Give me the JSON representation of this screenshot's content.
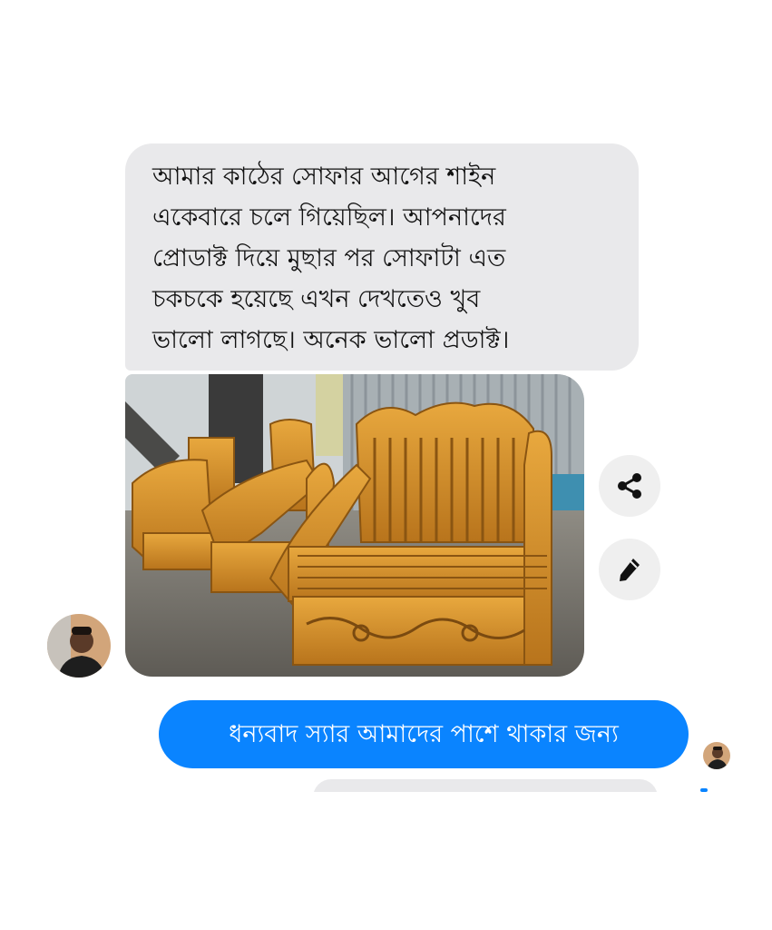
{
  "conversation": {
    "incoming_message": {
      "text": "আমার কাঠের সোফার আগের শাইন\nএকেবারে চলে গিয়েছিল। আপনাদের\nপ্রোডাক্ট দিয়ে মুছার পর সোফাটা এত\nচকচকে হয়েছে এখন দেখতেও খুব\nভালো লাগছে। অনেক ভালো প্রডাক্ট।",
      "bubble_color": "#e9e9eb"
    },
    "incoming_photo": {
      "subject": "carved-wooden-sofa-set"
    },
    "photo_actions": {
      "share_icon": "share-icon",
      "edit_icon": "pencil-icon"
    },
    "outgoing_message": {
      "text": "ধন্যবাদ স্যার আমাদের পাশে থাকার জন্য",
      "bubble_color": "#0a84ff"
    }
  },
  "colors": {
    "accent": "#0a84ff",
    "incoming_bubble": "#e9e9eb",
    "action_button": "#efefef"
  }
}
